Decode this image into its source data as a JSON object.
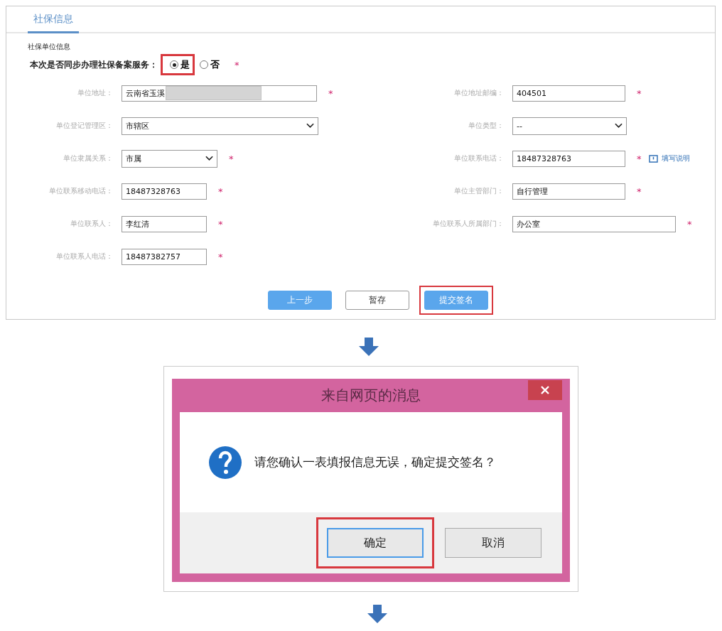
{
  "tab": {
    "label": "社保信息",
    "selected": true
  },
  "section_title": "社保单位信息",
  "sync_question": {
    "label": "本次是否同步办理社保备案服务：",
    "required_mark": "*",
    "options": [
      {
        "label": "是",
        "selected": true,
        "highlighted": true
      },
      {
        "label": "否",
        "selected": false,
        "highlighted": false
      }
    ]
  },
  "rows": [
    {
      "left": {
        "label": "单位地址：",
        "kind": "text",
        "value": "云南省玉溪",
        "redacted": true,
        "required_mark": "*"
      },
      "right": {
        "label": "单位地址邮编：",
        "kind": "text",
        "value": "404501",
        "required_mark": "*"
      }
    },
    {
      "left": {
        "label": "单位登记管理区：",
        "kind": "select",
        "value": "市辖区"
      },
      "right": {
        "label": "单位类型：",
        "kind": "select",
        "value": "--"
      }
    },
    {
      "left": {
        "label": "单位隶属关系：",
        "kind": "select",
        "value": "市属",
        "required_mark": "*"
      },
      "right": {
        "label": "单位联系电话：",
        "kind": "text",
        "value": "18487328763",
        "required_mark": "*",
        "help": "填写说明"
      }
    },
    {
      "left": {
        "label": "单位联系移动电话：",
        "kind": "text",
        "value": "18487328763",
        "required_mark": "*"
      },
      "right": {
        "label": "单位主管部门：",
        "kind": "text",
        "value": "自行管理",
        "required_mark": "*"
      }
    },
    {
      "left": {
        "label": "单位联系人：",
        "kind": "text",
        "value": "李红清",
        "required_mark": "*"
      },
      "right": {
        "label": "单位联系人所属部门：",
        "kind": "text",
        "value": "办公室",
        "required_mark": "*"
      }
    },
    {
      "left": {
        "label": "单位联系人电话：",
        "kind": "text",
        "value": "18487382757",
        "required_mark": "*"
      }
    }
  ],
  "buttons": [
    {
      "label": "上一步",
      "kind": "primary",
      "highlighted": false
    },
    {
      "label": "暂存",
      "kind": "default",
      "highlighted": false
    },
    {
      "label": "提交签名",
      "kind": "primary",
      "highlighted": true
    }
  ],
  "dialog": {
    "title": "来自网页的消息",
    "message": "请您确认一表填报信息无误，确定提交签名？",
    "buttons": [
      {
        "label": "确定",
        "focused": true,
        "highlighted": true
      },
      {
        "label": "取消",
        "focused": false,
        "highlighted": false
      }
    ]
  }
}
